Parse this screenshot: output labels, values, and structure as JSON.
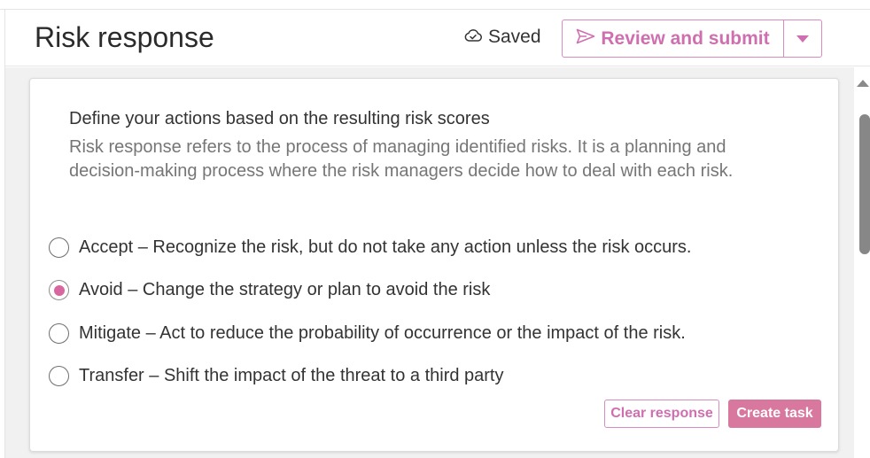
{
  "header": {
    "title": "Risk response",
    "saved_label": "Saved",
    "saved_icon": "cloud-check-icon",
    "review_label": "Review and submit",
    "review_icon": "send-icon",
    "dropdown_icon": "caret-down-icon"
  },
  "section": {
    "heading": "Define your actions based on the resulting risk scores",
    "description": "Risk response refers to the process of managing identified risks. It is a planning and decision-making process where the risk managers decide how to deal with each risk."
  },
  "options": [
    {
      "name": "accept",
      "label": "Accept – Recognize the risk, but do not take any action unless the risk occurs.",
      "selected": false
    },
    {
      "name": "avoid",
      "label": "Avoid – Change the strategy or plan to avoid the risk",
      "selected": true
    },
    {
      "name": "mitigate",
      "label": "Mitigate – Act to reduce the probability of occurrence or the impact of the risk.",
      "selected": false
    },
    {
      "name": "transfer",
      "label": "Transfer – Shift the impact of the threat to a third party",
      "selected": false
    }
  ],
  "actions": {
    "clear_label": "Clear response",
    "create_label": "Create task"
  },
  "colors": {
    "accent": "#cf6fb0",
    "accent_fill": "#d9789f",
    "radio_selected": "#d9679f"
  }
}
